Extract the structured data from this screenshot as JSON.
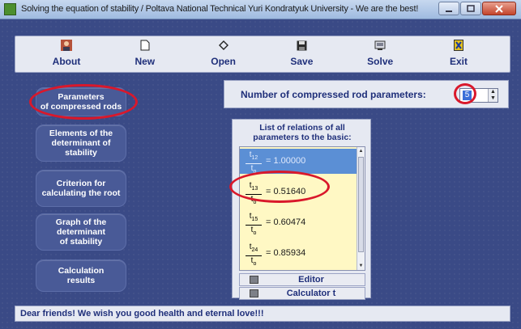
{
  "window": {
    "title": "Solving the equation of stability / Poltava National Technical Yuri Kondratyuk University - We are    the best!"
  },
  "toolbar": {
    "buttons": [
      {
        "label": "About",
        "icon": "person-icon"
      },
      {
        "label": "New",
        "icon": "new-document-icon"
      },
      {
        "label": "Open",
        "icon": "open-icon"
      },
      {
        "label": "Save",
        "icon": "floppy-disk-icon"
      },
      {
        "label": "Solve",
        "icon": "solve-icon"
      },
      {
        "label": "Exit",
        "icon": "exit-icon"
      }
    ]
  },
  "nav": {
    "items": [
      {
        "label": "Parameters\nof compressed rods",
        "highlighted": true
      },
      {
        "label": "Elements of the\ndeterminant of\nstability"
      },
      {
        "label": "Criterion for\ncalculating the root"
      },
      {
        "label": "Graph of the\ndeterminant\nof stability"
      },
      {
        "label": "Calculation\nresults"
      }
    ]
  },
  "params": {
    "label": "Number of compressed rod parameters:",
    "value": "5"
  },
  "relations": {
    "title": "List of relations of all\nparameters to the basic:",
    "rows": [
      {
        "num": "t",
        "num_sub": "12",
        "den": "t",
        "den_sub": "o",
        "value": "1.00000",
        "selected": true
      },
      {
        "num": "t",
        "num_sub": "13",
        "den": "t",
        "den_sub": "o",
        "value": "0.51640",
        "selected": false
      },
      {
        "num": "t",
        "num_sub": "15",
        "den": "t",
        "den_sub": "o",
        "value": "0.60474",
        "selected": false
      },
      {
        "num": "t",
        "num_sub": "24",
        "den": "t",
        "den_sub": "o",
        "value": "0.85934",
        "selected": false
      }
    ],
    "editor_label": "Editor",
    "calculator_label": "Calculator t"
  },
  "status": {
    "text": "Dear friends! We wish you good health and eternal love!!!"
  },
  "colors": {
    "background": "#3a4a86",
    "panel": "#e6e9f2",
    "highlight_ellipse": "#d9182b",
    "selected_row": "#5b8fd5",
    "list_background": "#fff8c4"
  }
}
